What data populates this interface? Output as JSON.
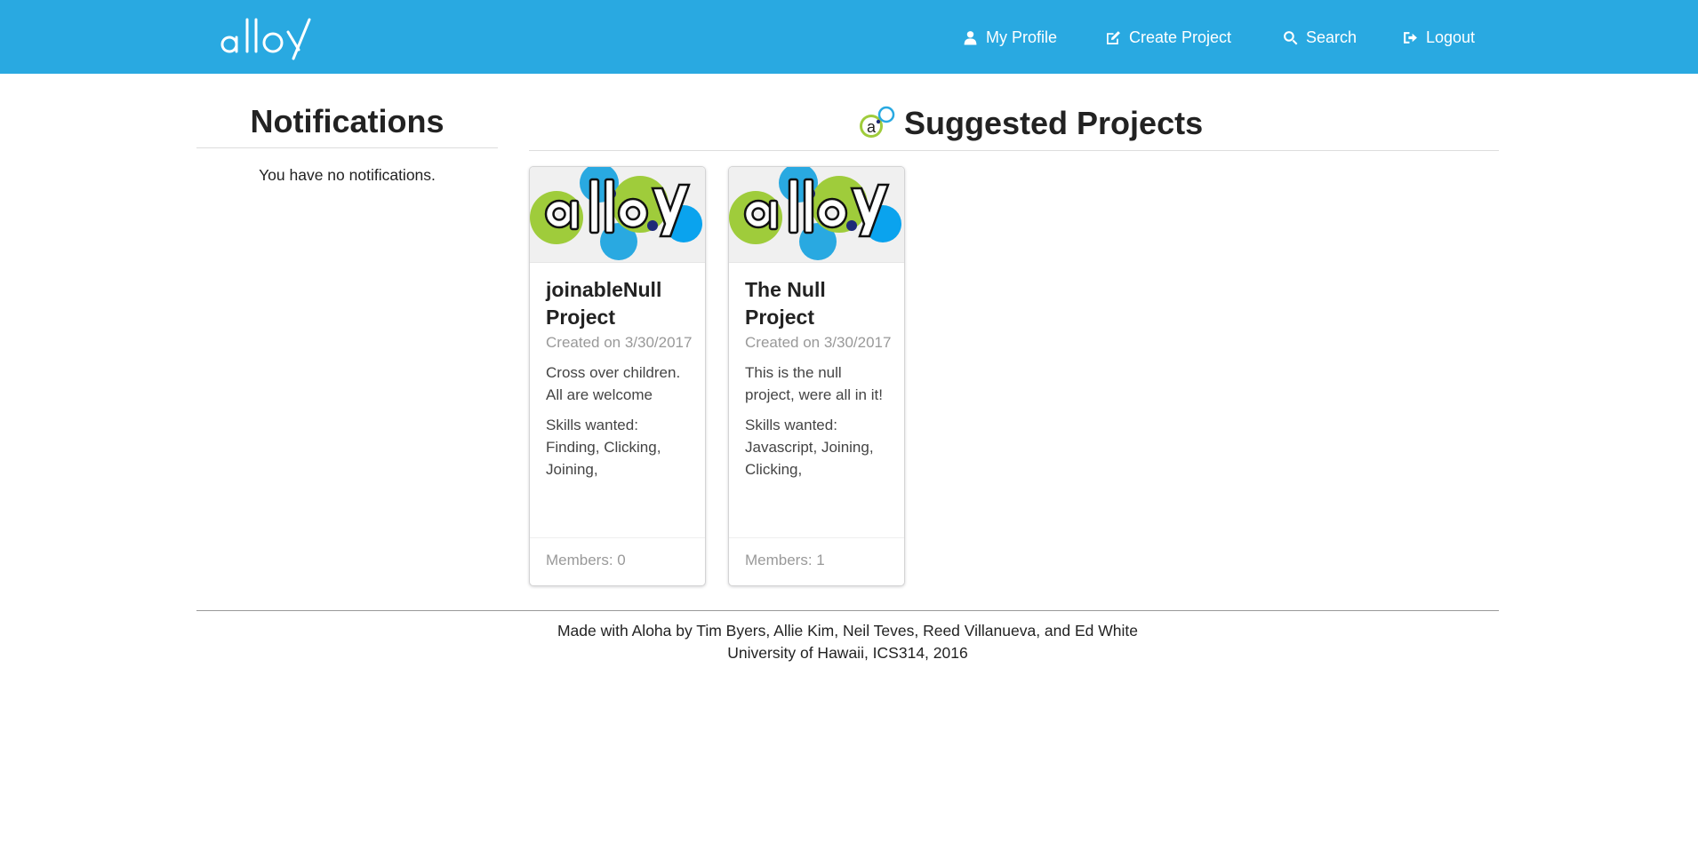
{
  "navbar": {
    "brand": "alloy",
    "items": [
      {
        "label": "My Profile",
        "icon": "user-icon"
      },
      {
        "label": "Create Project",
        "icon": "edit-icon"
      },
      {
        "label": "Search",
        "icon": "search-icon"
      },
      {
        "label": "Logout",
        "icon": "logout-icon"
      }
    ],
    "color": "#29a9e1"
  },
  "notifications": {
    "title": "Notifications",
    "empty_text": "You have no notifications."
  },
  "suggested": {
    "title": "Suggested Projects",
    "cards": [
      {
        "title": "joinableNull Project",
        "created": "Created on 3/30/2017",
        "description": "Cross over children. All are welcome",
        "skills": "Skills wanted: Finding, Clicking, Joining,",
        "members": "Members: 0"
      },
      {
        "title": "The Null Project",
        "created": "Created on 3/30/2017",
        "description": "This is the null project, were all in it!",
        "skills": "Skills wanted: Javascript, Joining, Clicking,",
        "members": "Members: 1"
      }
    ]
  },
  "footer": {
    "line1": "Made with Aloha by Tim Byers, Allie Kim, Neil Teves, Reed Villanueva, and Ed White",
    "line2": "University of Hawaii, ICS314, 2016"
  }
}
